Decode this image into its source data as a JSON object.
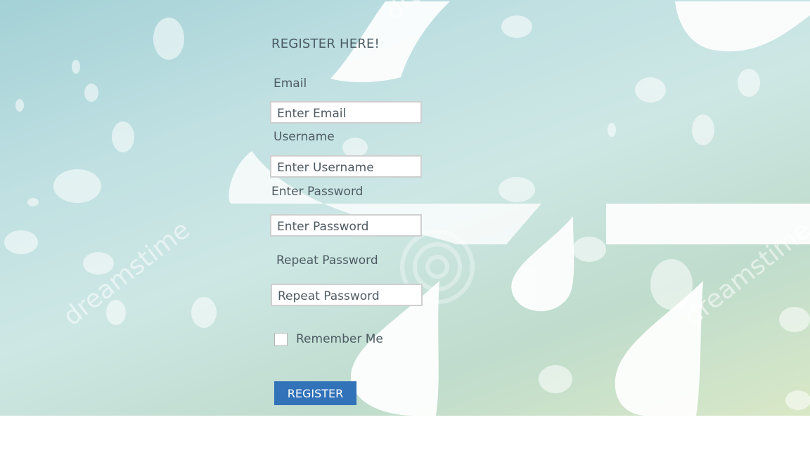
{
  "background": {
    "watermark_text": "dreamstime",
    "gradient_colors": [
      "#a3d1d6",
      "#cde7e4",
      "#d9e8c6"
    ]
  },
  "form": {
    "title": "REGISTER HERE!",
    "email": {
      "label": "Email",
      "placeholder": "Enter Email",
      "value": ""
    },
    "username": {
      "label": "Username",
      "placeholder": "Enter Username",
      "value": ""
    },
    "password": {
      "label": "Enter Password",
      "placeholder": "Enter Password",
      "value": ""
    },
    "repeat_password": {
      "label": "Repeat Password",
      "placeholder": "Repeat Password",
      "value": ""
    },
    "remember_me": {
      "label": "Remember Me",
      "checked": false
    },
    "submit_label": "REGISTER",
    "submit_color": "#3272b8"
  }
}
